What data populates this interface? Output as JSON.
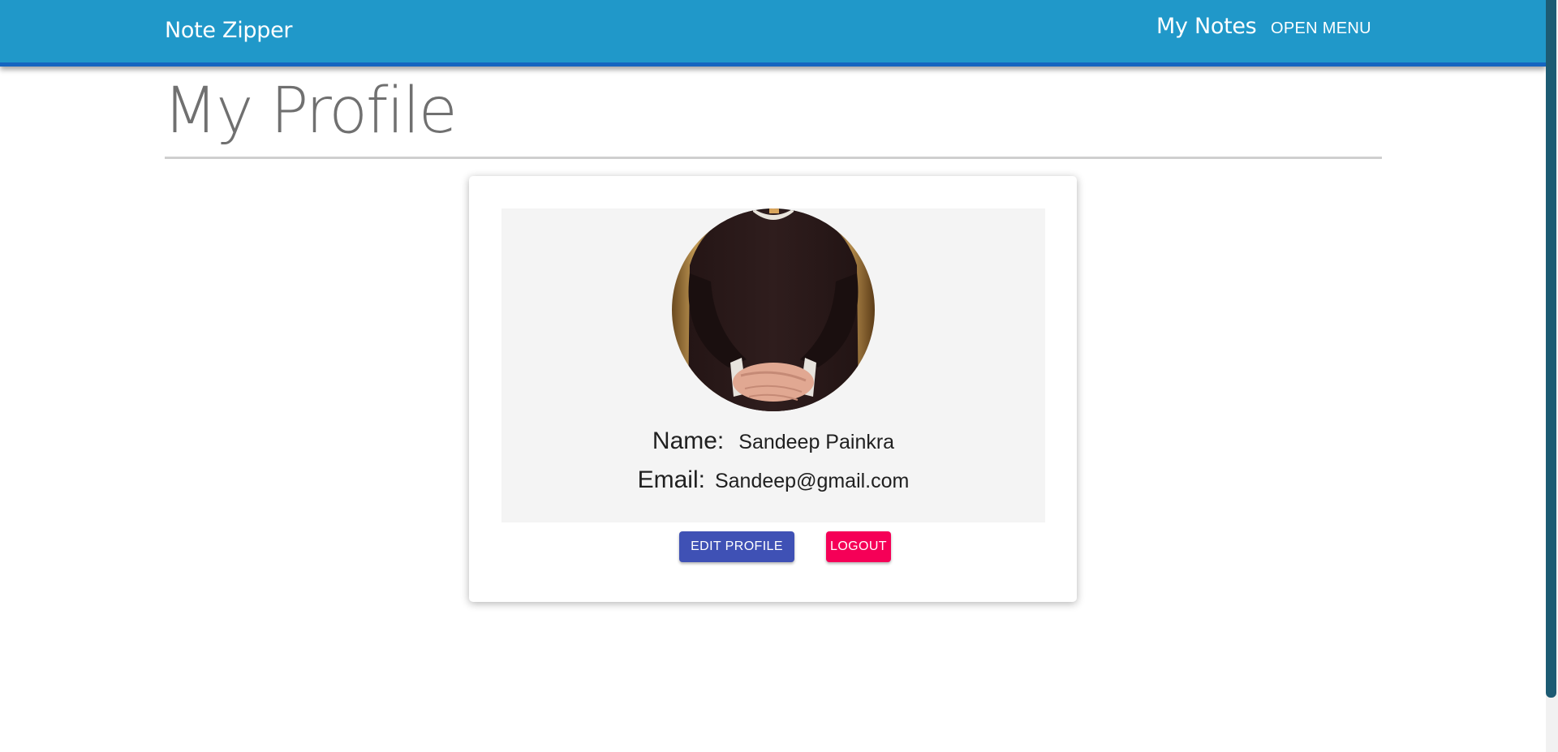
{
  "navbar": {
    "brand": "Note Zipper",
    "my_notes_link": "My Notes",
    "menu_button": "OPEN MENU"
  },
  "page": {
    "title": "My Profile"
  },
  "profile": {
    "name_label": "Name:",
    "name_value": "Sandeep Painkra",
    "email_label": "Email:",
    "email_value": "Sandeep@gmail.com",
    "edit_button": "EDIT PROFILE",
    "logout_button": "LOGOUT"
  },
  "colors": {
    "navbar_bg": "#2098c9",
    "navbar_border": "#1565c0",
    "edit_button_bg": "#3f51b5",
    "logout_button_bg": "#f50057",
    "title_text": "#707070"
  }
}
